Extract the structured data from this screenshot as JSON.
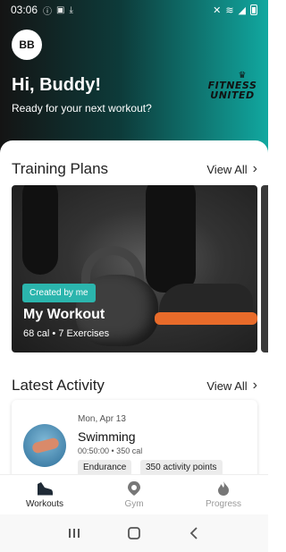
{
  "status_bar": {
    "time": "03:06",
    "left_icons": [
      "info-icon",
      "clipboard-icon",
      "download-icon"
    ],
    "right_icons": [
      "mute-icon",
      "wifi-icon",
      "signal-icon",
      "battery-icon"
    ]
  },
  "header": {
    "avatar_initials": "BB",
    "greeting": "Hi, Buddy!",
    "subtitle": "Ready for your next workout?",
    "logo_line1": "FITNESS",
    "logo_line2": "UNITED",
    "gradient_colors": [
      "#141414",
      "#0d3b3a",
      "#11a8a0"
    ]
  },
  "training_plans": {
    "title": "Training Plans",
    "view_all": "View All",
    "card": {
      "badge": "Created by me",
      "title": "My Workout",
      "meta": "68 cal • 7 Exercises",
      "badge_color": "#2bb5ad"
    }
  },
  "latest_activity": {
    "title": "Latest Activity",
    "view_all": "View All",
    "item": {
      "date": "Mon, Apr 13",
      "name": "Swimming",
      "meta": "00:50:00 • 350 cal",
      "chips": [
        "Endurance",
        "350 activity points"
      ]
    }
  },
  "tabs": [
    {
      "label": "Workouts",
      "icon": "shoe-icon",
      "active": true
    },
    {
      "label": "Gym",
      "icon": "location-pin-icon",
      "active": false
    },
    {
      "label": "Progress",
      "icon": "flame-icon",
      "active": false
    }
  ],
  "nav": [
    "recent-apps-icon",
    "home-icon",
    "back-icon"
  ]
}
